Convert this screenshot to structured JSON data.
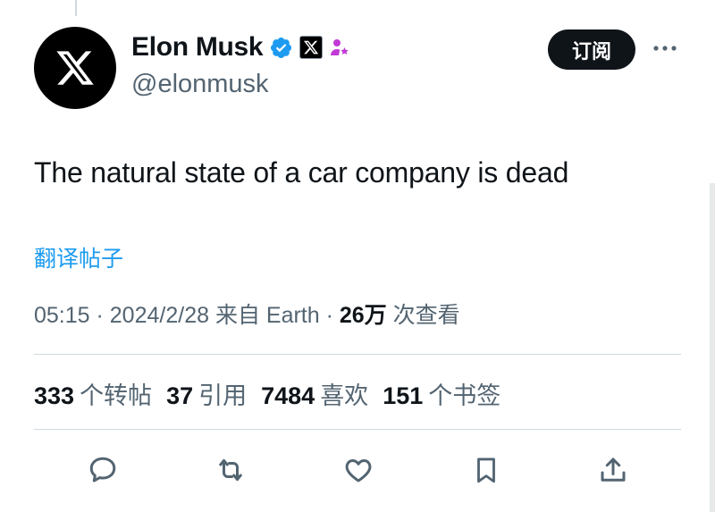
{
  "user": {
    "display_name": "Elon Musk",
    "handle": "@elonmusk",
    "avatar_icon": "x-logo-icon",
    "verified_color": "#1d9bf0",
    "affiliate_icon": "x-affiliate-badge-icon",
    "extra_badge_icon": "person-star-icon",
    "extra_badge_color": "#c13ad6"
  },
  "header": {
    "subscribe_label": "订阅",
    "more_icon": "more-horizontal-icon"
  },
  "tweet": {
    "text": "The natural state of a car company is dead",
    "translate_label": "翻译帖子"
  },
  "meta": {
    "time": "05:15",
    "sep1": " · ",
    "date": "2024/2/28",
    "source": " 来自 Earth",
    "sep2": " · ",
    "views": "26万",
    "views_label": " 次查看"
  },
  "stats": [
    {
      "value": "333",
      "label": "个转帖"
    },
    {
      "value": "37",
      "label": "引用"
    },
    {
      "value": "7484",
      "label": "喜欢"
    },
    {
      "value": "151",
      "label": "个书签"
    }
  ],
  "actions": [
    "reply-icon",
    "repost-icon",
    "like-icon",
    "bookmark-icon",
    "share-icon"
  ]
}
